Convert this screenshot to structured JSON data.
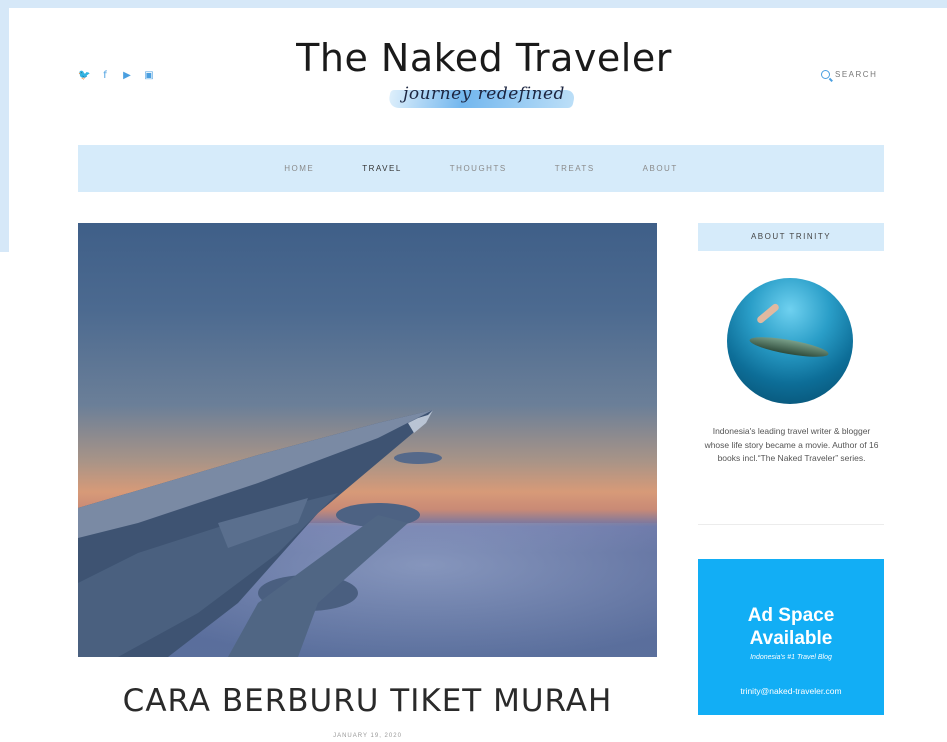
{
  "header": {
    "title": "The Naked Traveler",
    "tagline": "journey redefined",
    "search_label": "SEARCH",
    "social": [
      {
        "icon": "twitter-icon",
        "glyph": "♥"
      },
      {
        "icon": "facebook-icon",
        "glyph": "f"
      },
      {
        "icon": "youtube-icon",
        "glyph": "▶"
      },
      {
        "icon": "instagram-icon",
        "glyph": "▣"
      }
    ]
  },
  "nav": {
    "items": [
      "HOME",
      "TRAVEL",
      "THOUGHTS",
      "TREATS",
      "ABOUT"
    ],
    "active": "TRAVEL"
  },
  "post": {
    "title": "CARA BERBURU TIKET MURAH",
    "date": "JANUARY 19, 2020"
  },
  "sidebar": {
    "about_heading": "ABOUT TRINITY",
    "about_text": "Indonesia's leading travel writer & blogger whose life story became a movie. Author of 16 books incl.“The Naked Traveler” series.",
    "ad": {
      "headline_1": "Ad Space",
      "headline_2": "Available",
      "tagline": "Indonesia's #1 Travel Blog",
      "email": "trinity@naked-traveler.com"
    }
  },
  "colors": {
    "accent": "#4a9fe0",
    "nav_bg": "#d6ebfa",
    "ad_bg": "#12aef5"
  }
}
